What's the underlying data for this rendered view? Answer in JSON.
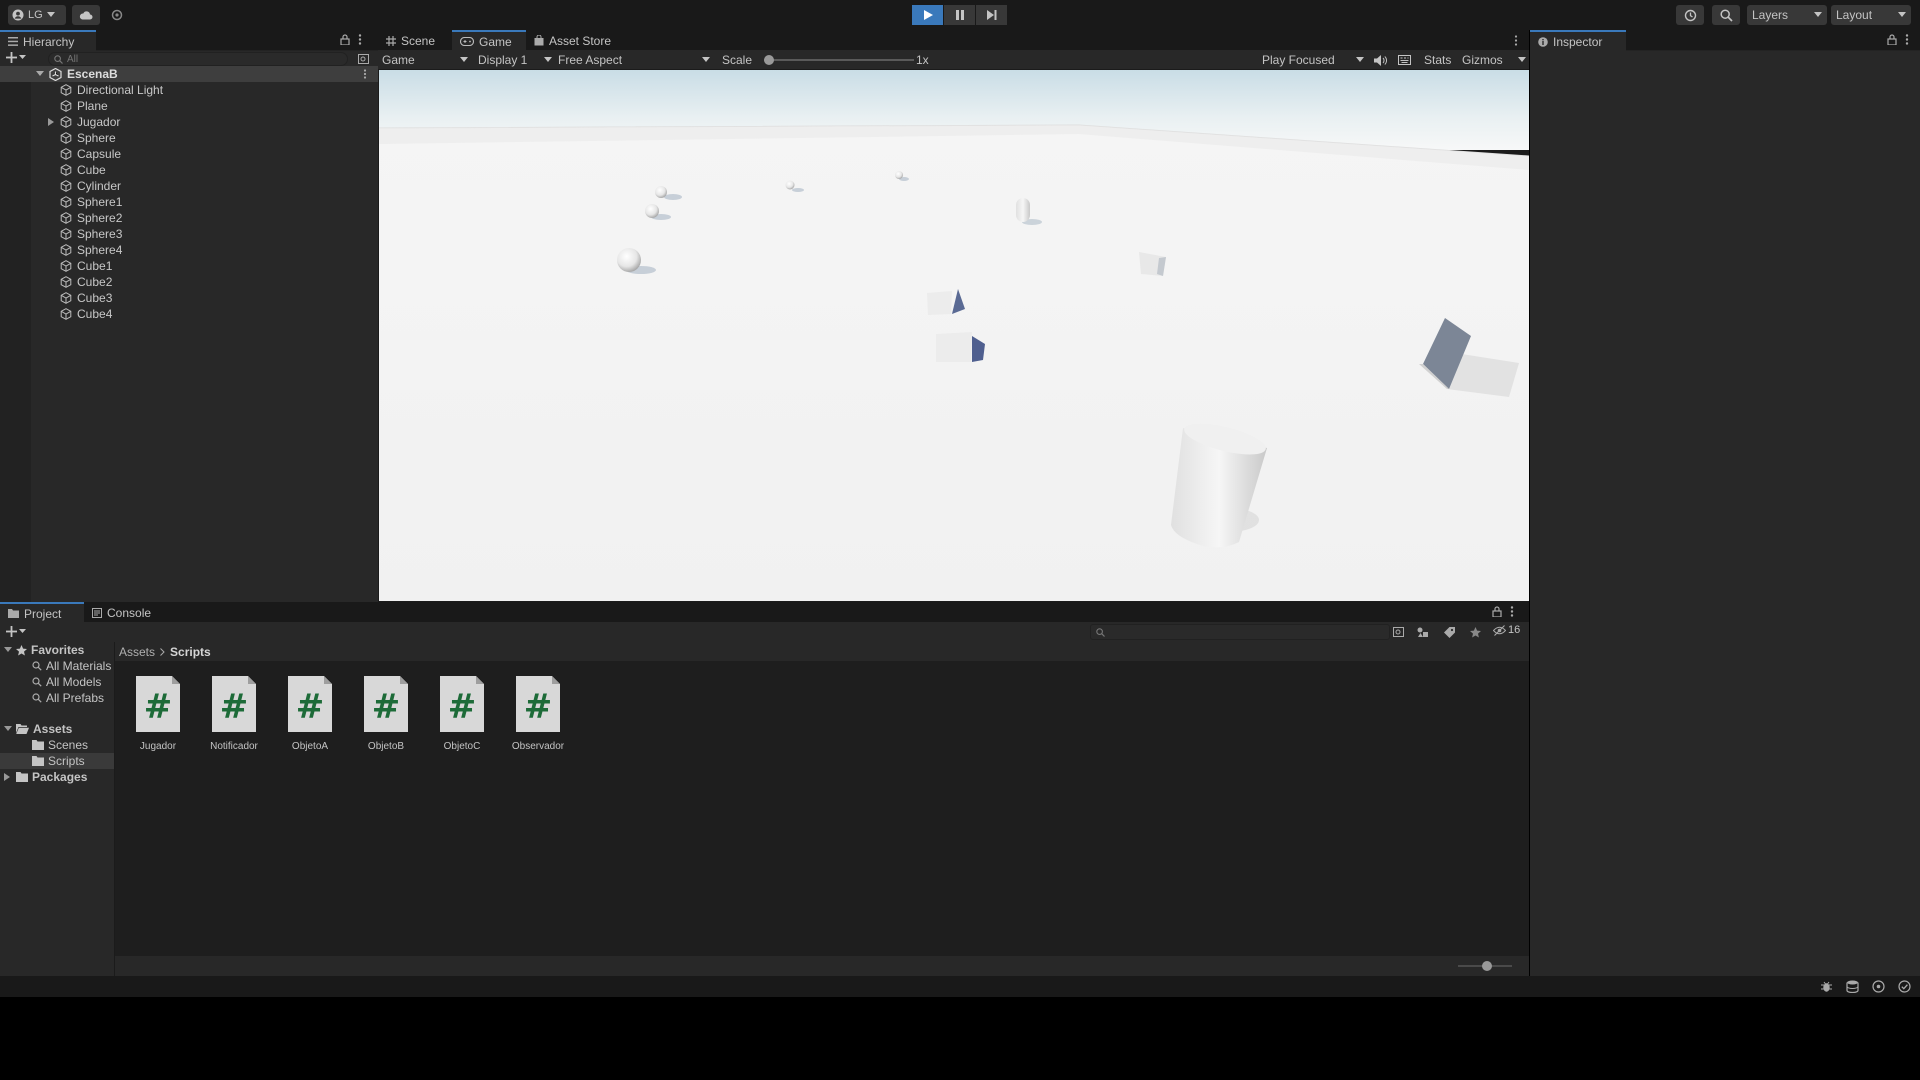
{
  "toolbar": {
    "account_label": "LG",
    "layers_label": "Layers",
    "layout_label": "Layout"
  },
  "hierarchy": {
    "tab_label": "Hierarchy",
    "search_placeholder": "All",
    "scene_name": "EscenaB",
    "items": [
      {
        "label": "Directional Light",
        "expandable": false
      },
      {
        "label": "Plane",
        "expandable": false
      },
      {
        "label": "Jugador",
        "expandable": true
      },
      {
        "label": "Sphere",
        "expandable": false
      },
      {
        "label": "Capsule",
        "expandable": false
      },
      {
        "label": "Cube",
        "expandable": false
      },
      {
        "label": "Cylinder",
        "expandable": false
      },
      {
        "label": "Sphere1",
        "expandable": false
      },
      {
        "label": "Sphere2",
        "expandable": false
      },
      {
        "label": "Sphere3",
        "expandable": false
      },
      {
        "label": "Sphere4",
        "expandable": false
      },
      {
        "label": "Cube1",
        "expandable": false
      },
      {
        "label": "Cube2",
        "expandable": false
      },
      {
        "label": "Cube3",
        "expandable": false
      },
      {
        "label": "Cube4",
        "expandable": false
      }
    ]
  },
  "center_tabs": {
    "scene": "Scene",
    "game": "Game",
    "asset_store": "Asset Store"
  },
  "game_toolbar": {
    "view_dropdown": "Game",
    "display_dropdown": "Display 1",
    "aspect_dropdown": "Free Aspect",
    "scale_label": "Scale",
    "scale_value": "1x",
    "scale_slider_fraction": 0.0,
    "play_mode_dropdown": "Play Focused",
    "stats_label": "Stats",
    "gizmos_label": "Gizmos"
  },
  "inspector": {
    "tab_label": "Inspector"
  },
  "project": {
    "project_tab": "Project",
    "console_tab": "Console",
    "hidden_count": "16",
    "breadcrumb": [
      "Assets",
      "Scripts"
    ],
    "favorites": {
      "label": "Favorites",
      "items": [
        "All Materials",
        "All Models",
        "All Prefabs"
      ]
    },
    "assets_tree": {
      "label": "Assets",
      "children": [
        "Scenes",
        "Scripts"
      ],
      "selected": "Scripts"
    },
    "packages_label": "Packages",
    "scripts": [
      "Jugador",
      "Notificador",
      "ObjetoA",
      "ObjetoB",
      "ObjetoC",
      "Observador"
    ],
    "icon_size_fraction": 0.55
  },
  "colors": {
    "accent": "#3a79bb",
    "panel_bg": "#282828",
    "toolbar_bg": "#191919",
    "script_hash": "#1d6b38"
  }
}
